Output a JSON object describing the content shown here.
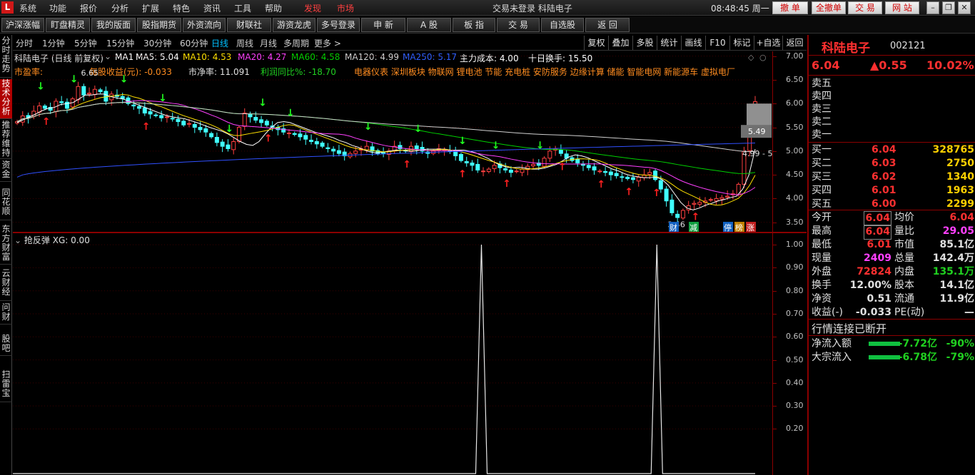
{
  "menubar": {
    "logo": "L",
    "items": [
      "系统",
      "功能",
      "报价",
      "分析",
      "扩展",
      "特色",
      "资讯",
      "工具",
      "帮助"
    ],
    "red_items": [
      "发现",
      "市场"
    ],
    "center_title": "交易未登录   科陆电子",
    "time": "08:48:45 周一",
    "right_buttons": [
      "撤 单",
      "全撤单",
      "交 易",
      "网 站"
    ]
  },
  "toolbar": {
    "buttons": [
      "沪深涨幅",
      "盯盘精灵",
      "我的版面",
      "股指期货",
      "外资流向",
      "财联社",
      "游资龙虎",
      "多号登录",
      "申 新",
      "A 股",
      "板 指",
      "交 易",
      "自选股",
      "返 回"
    ]
  },
  "left_tabs": [
    "分时走势",
    "技术分析",
    "推荐维持",
    "资金",
    "同花顺",
    "东方财富",
    "云财经",
    "问财",
    "股吧",
    "扫雷宝"
  ],
  "period_bar": {
    "items": [
      "分时",
      "1分钟",
      "5分钟",
      "15分钟",
      "30分钟",
      "60分钟",
      "日线",
      "周线",
      "月线",
      "多周期",
      "更多 >"
    ],
    "selected": "日线",
    "right_items": [
      "复权",
      "叠加",
      "多股",
      "统计",
      "画线",
      "F10",
      "标记",
      "+自选",
      "返回"
    ]
  },
  "info": {
    "stock_line": "科陆电子 (日线 前复权)",
    "ma1": "MA1",
    "ma5": "MA5: 5.04",
    "ma10": "MA10: 4.53",
    "ma20": "MA20: 4.27",
    "ma60": "MA60: 4.58",
    "ma120": "MA120: 4.99",
    "ma250": "MA250: 5.17",
    "main_cost": "主力成本: 4.00",
    "ten_day_turnover": "十日换手: 15.50",
    "pe_label": "市盈率:",
    "eps": "每股收益(元):  -0.033",
    "pb": "市净率:   11.091",
    "profit_yoy": "利润同比%: -18.70",
    "concepts": "电器仪表  深圳板块  物联网  锂电池  节能  充电桩  安防服务  边缘计算  储能  智能电网  新能源车  虚拟电厂",
    "high_mark": "6.65",
    "low_mark": "3.46",
    "price_tag": "5.49",
    "last_tag": "4.99 - 5"
  },
  "markers": [
    "财",
    "减",
    "停",
    "榜",
    "涨"
  ],
  "indicator": {
    "name": "抢反弹",
    "value": "XG: 0.00"
  },
  "colors": {
    "ma1": "#ffffff",
    "ma5": "#ffffff",
    "ma10": "#ffe000",
    "ma20": "#ff40ff",
    "ma60": "#00d000",
    "ma120": "#d0d0d0",
    "ma250": "#3050ff",
    "up": "#ff4040",
    "down": "#40ffff"
  },
  "chart_data": [
    {
      "type": "candlestick",
      "title": "科陆电子 日线",
      "ylim": [
        3.3,
        7.1
      ],
      "yticks": [
        "7.00",
        "6.50",
        "6.00",
        "5.50",
        "5.00",
        "4.50",
        "4.00",
        "3.50"
      ],
      "close": [
        5.62,
        5.74,
        5.7,
        5.84,
        5.95,
        5.9,
        5.86,
        6.05,
        6.02,
        5.9,
        6.1,
        6.36,
        6.18,
        6.22,
        6.3,
        6.25,
        6.05,
        6.2,
        6.15,
        6.1,
        6.0,
        5.95,
        5.9,
        5.8,
        5.78,
        5.75,
        5.7,
        5.72,
        5.68,
        5.62,
        5.55,
        5.58,
        5.5,
        5.45,
        5.4,
        5.3,
        5.18,
        5.1,
        5.05,
        5.2,
        5.5,
        5.8,
        5.72,
        5.65,
        5.6,
        5.55,
        5.5,
        5.45,
        5.4,
        5.38,
        5.35,
        5.3,
        5.25,
        5.2,
        5.15,
        5.1,
        5.05,
        5.0,
        4.95,
        4.9,
        4.95,
        5.0,
        5.05,
        5.1,
        5.0,
        4.95,
        4.95,
        5.0,
        5.1,
        5.05,
        5.0,
        5.1,
        5.05,
        5.0,
        4.95,
        5.0,
        5.05,
        5.02,
        5.0,
        4.9,
        4.8,
        4.75,
        4.7,
        4.6,
        4.58,
        4.62,
        4.7,
        4.65,
        4.6,
        4.55,
        4.58,
        4.62,
        4.68,
        4.72,
        4.7,
        4.85,
        5.0,
        5.05,
        4.95,
        4.85,
        4.8,
        4.75,
        4.7,
        4.65,
        4.6,
        4.58,
        4.55,
        4.5,
        4.48,
        4.45,
        4.42,
        4.4,
        4.45,
        4.5,
        4.55,
        4.4,
        4.2,
        3.95,
        3.7,
        3.6,
        3.75,
        3.85,
        3.9,
        3.92,
        3.95,
        3.98,
        4.0,
        4.02,
        4.05,
        4.1,
        4.3,
        4.99,
        5.49,
        6.04
      ],
      "ma5": [
        5.6,
        5.66,
        5.72,
        5.78,
        5.85,
        5.9,
        5.92,
        5.98,
        6.0,
        6.02,
        6.1,
        6.18,
        6.18,
        6.2,
        6.2,
        6.15,
        6.12,
        6.1,
        6.05,
        6.0,
        5.95,
        5.9,
        5.85,
        5.8,
        5.75,
        5.72,
        5.7,
        5.68,
        5.64,
        5.6,
        5.55,
        5.5,
        5.46,
        5.42,
        5.36,
        5.28,
        5.2,
        5.14,
        5.12,
        5.2,
        5.36,
        5.5,
        5.6,
        5.62,
        5.6,
        5.55,
        5.5,
        5.45,
        5.4,
        5.36,
        5.32,
        5.28,
        5.22,
        5.18,
        5.12,
        5.08,
        5.02,
        4.98,
        4.96,
        4.98,
        5.0,
        5.02,
        5.02,
        5.0,
        5.0,
        5.02,
        5.04,
        5.04,
        5.04,
        5.04,
        5.02,
        5.02,
        5.02,
        5.0,
        4.96,
        4.9,
        4.84,
        4.76,
        4.7,
        4.66,
        4.65,
        4.66,
        4.64,
        4.62,
        4.62,
        4.64,
        4.68,
        4.72,
        4.8,
        4.88,
        4.92,
        4.9,
        4.86,
        4.8,
        4.74,
        4.68,
        4.62,
        4.58,
        4.52,
        4.48,
        4.46,
        4.44,
        4.44,
        4.45,
        4.4,
        4.28,
        4.1,
        3.92,
        3.8,
        3.76,
        3.8,
        3.86,
        3.9,
        3.95,
        3.98,
        4.02,
        4.05,
        4.2,
        4.5,
        5.04
      ]
    },
    {
      "type": "line",
      "title": "抢反弹",
      "ylim": [
        0,
        1.05
      ],
      "yticks": [
        "1.00",
        "0.90",
        "0.80",
        "0.70",
        "0.60",
        "0.50",
        "0.40",
        "0.30",
        "0.20"
      ],
      "signal_positions": [
        0.617,
        0.848
      ],
      "values": [
        1,
        1
      ]
    }
  ],
  "right_panel": {
    "name": "科陆电子",
    "code": "002121",
    "price": "6.04",
    "change": "▲0.55",
    "pct": "10.02%",
    "sell": [
      [
        "卖五",
        "",
        ""
      ],
      [
        "卖四",
        "",
        ""
      ],
      [
        "卖三",
        "",
        ""
      ],
      [
        "卖二",
        "",
        ""
      ],
      [
        "卖一",
        "",
        ""
      ]
    ],
    "buy": [
      [
        "买一",
        "6.04",
        "328765"
      ],
      [
        "买二",
        "6.03",
        "2750"
      ],
      [
        "买三",
        "6.02",
        "1340"
      ],
      [
        "买四",
        "6.01",
        "1963"
      ],
      [
        "买五",
        "6.00",
        "2299"
      ]
    ],
    "stats": [
      [
        "今开",
        "6.04",
        "均价",
        "6.04"
      ],
      [
        "最高",
        "6.04",
        "量比",
        "29.05"
      ],
      [
        "最低",
        "6.01",
        "市值",
        "85.1亿"
      ],
      [
        "现量",
        "2409",
        "总量",
        "142.4万"
      ],
      [
        "外盘",
        "72824",
        "内盘",
        "135.1万"
      ],
      [
        "换手",
        "12.00%",
        "股本",
        "14.1亿"
      ],
      [
        "净资",
        "0.51",
        "流通",
        "11.9亿"
      ],
      [
        "收益(-)",
        "-0.033",
        "PE(动)",
        "—"
      ]
    ],
    "notice": "行情连接已断开",
    "flows": [
      [
        "净流入额",
        "-7.72亿",
        "-90%"
      ],
      [
        "大宗流入",
        "-6.78亿",
        "-79%"
      ]
    ]
  }
}
